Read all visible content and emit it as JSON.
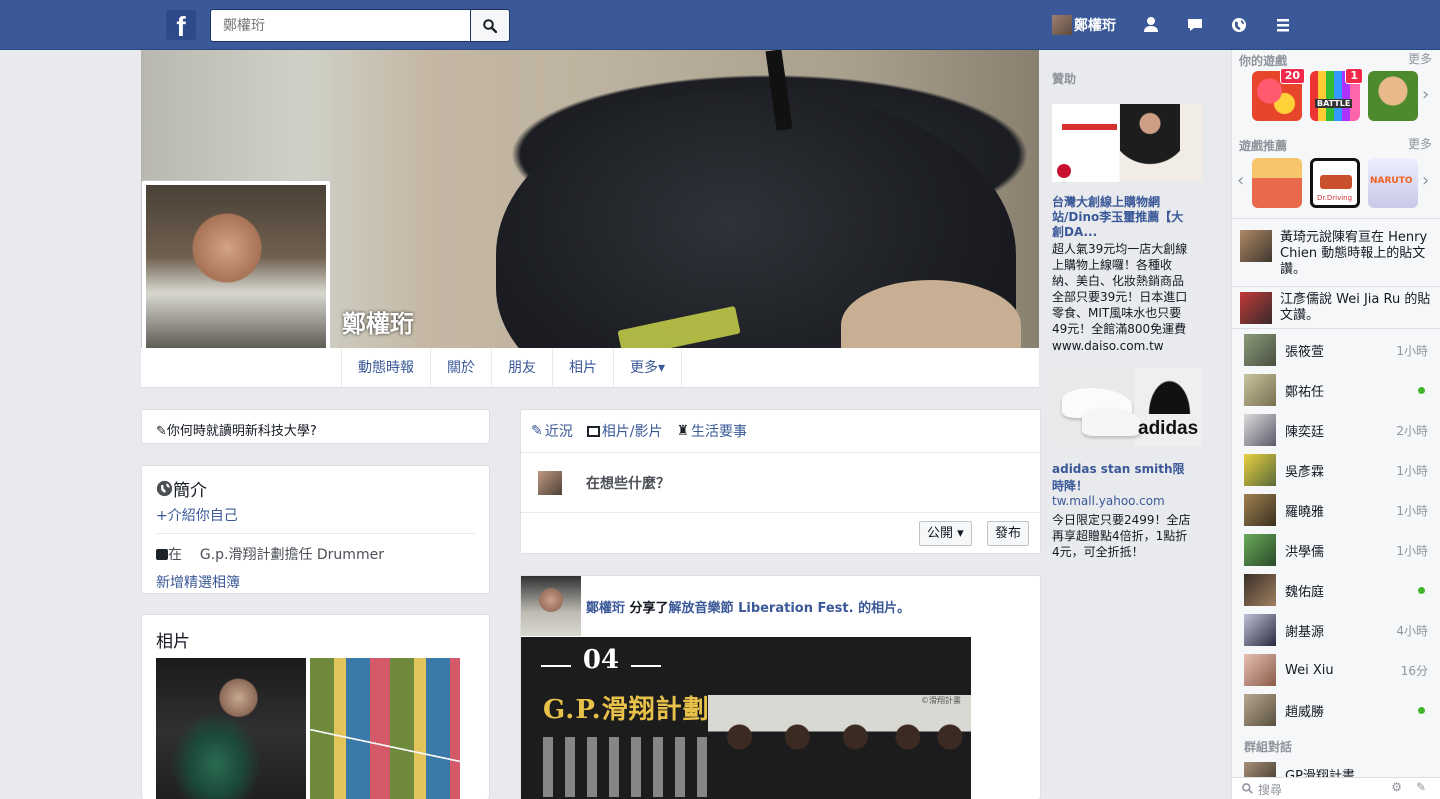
{
  "topbar": {
    "logo": "f",
    "search_placeholder": "鄭權珩",
    "user_name": "鄭權珩",
    "icons": [
      "search-icon",
      "friends-icon",
      "messages-icon",
      "notifications-icon",
      "menu-icon"
    ]
  },
  "profile": {
    "name": "鄭權珩",
    "tabs": [
      "動態時報",
      "關於",
      "朋友",
      "相片",
      "更多▾"
    ]
  },
  "left": {
    "education_prompt": "你何時就讀明新科技大學?",
    "intro": {
      "title": "簡介",
      "add_intro": "+介紹你自己",
      "work_prefix": "在",
      "work_text": "G.p.滑翔計劃擔任 Drummer",
      "featured": "新增精選相簿"
    },
    "photos_title": "相片"
  },
  "composer": {
    "tabs": [
      "近況",
      "相片/影片",
      "生活要事"
    ],
    "placeholder": "在想些什麼？",
    "privacy": "公開",
    "post_button": "發布"
  },
  "post": {
    "author": "鄭權珩",
    "verb": " 分享了",
    "target": "解放音樂節 Liberation Fest. 的相片。",
    "image": {
      "number": "04",
      "band": "G.P.滑翔計劃",
      "credit": "©滑翔計畫"
    }
  },
  "sponsored": {
    "heading": "贊助",
    "ads": [
      {
        "title": "台灣大創線上購物網站/Dino李玉璽推薦【大創DA...",
        "body": "超人氣39元均一店大創線上購物上線囉！各種收納、美白、化妝熱銷商品全部只要39元！日本進口零食、MIT風味水也只要49元！全館滿800免運費",
        "url": "www.daiso.com.tw"
      },
      {
        "image_text": "adidas",
        "title": "adidas stan smith限時降！",
        "url": "tw.mall.yahoo.com",
        "body": "今日限定只要2499！全店再享超贈點4倍折，1點折4元，可全折抵！"
      }
    ]
  },
  "chat": {
    "your_games": "你的遊戲",
    "more": "更多",
    "games_recommended": "遊戲推薦",
    "game_badges": [
      "20",
      "1"
    ],
    "game_labels": [
      "BATTLE",
      "Dr.Driving",
      "NARUTO"
    ],
    "ticker": [
      "黃琦元說陳宥亘在 Henry Chien 動態時報上的貼文讚。",
      "江彥儒說 Wei Jia Ru 的貼文讚。"
    ],
    "contacts": [
      {
        "name": "張筱萱",
        "status": "1小時",
        "online": false
      },
      {
        "name": "鄭祐任",
        "status": "",
        "online": true
      },
      {
        "name": "陳奕廷",
        "status": "2小時",
        "online": false
      },
      {
        "name": "吳彥霖",
        "status": "1小時",
        "online": false
      },
      {
        "name": "羅曉雅",
        "status": "1小時",
        "online": false
      },
      {
        "name": "洪學儒",
        "status": "1小時",
        "online": false
      },
      {
        "name": "魏佑庭",
        "status": "",
        "online": true
      },
      {
        "name": "謝基源",
        "status": "4小時",
        "online": false
      },
      {
        "name": "Wei Xiu",
        "status": "16分",
        "online": false
      },
      {
        "name": "趙威勝",
        "status": "",
        "online": true
      }
    ],
    "group_heading": "群組對話",
    "group_name": "GP滑翔計畫",
    "search_placeholder": "搜尋"
  },
  "colors": {
    "brand": "#3b5998",
    "link": "#3b5998",
    "online": "#42b72a",
    "badge": "#f02849"
  }
}
